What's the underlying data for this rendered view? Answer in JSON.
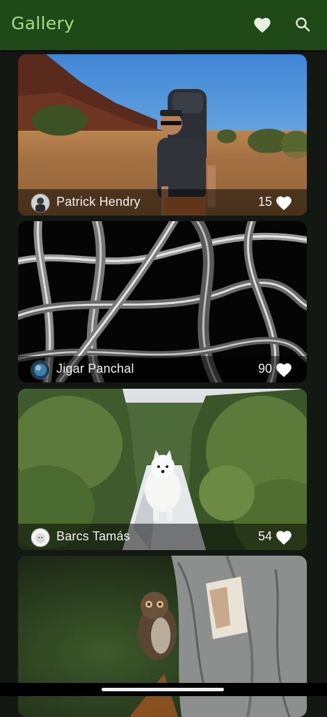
{
  "appbar": {
    "title": "Gallery",
    "favorites_icon": "heart-icon",
    "search_icon": "search-icon"
  },
  "colors": {
    "appbar": "#1f4a17",
    "title": "#a8d88c",
    "background": "#141813"
  },
  "photos": [
    {
      "author": "Patrick Hendry",
      "likes": "15",
      "scene": "hiker-desert"
    },
    {
      "author": "Jigar Panchal",
      "likes": "90",
      "scene": "abstract-chrome"
    },
    {
      "author": "Barcs Tamás",
      "likes": "54",
      "scene": "white-dog-forest"
    },
    {
      "author": "",
      "likes": "",
      "scene": "owl-on-tree"
    }
  ]
}
